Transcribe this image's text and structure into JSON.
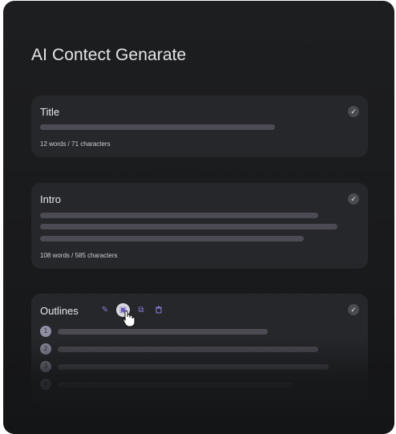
{
  "page": {
    "title": "AI Contect Genarate"
  },
  "cards": {
    "title": {
      "label": "Title",
      "meta": "12 words / 71 characters"
    },
    "intro": {
      "label": "Intro",
      "meta": "108 words / 585 characters"
    },
    "outlines": {
      "label": "Outlines",
      "numbers": [
        "1",
        "2",
        "3",
        "4"
      ]
    }
  },
  "icons": {
    "check": "✓",
    "pencil": "✎",
    "save": "▣",
    "copy": "⧉",
    "trash": "🗑"
  },
  "colors": {
    "background": "#1a1b1d",
    "card": "#26272a",
    "placeholder_bar": "#4c4b53",
    "accent": "#8b7fe0"
  }
}
